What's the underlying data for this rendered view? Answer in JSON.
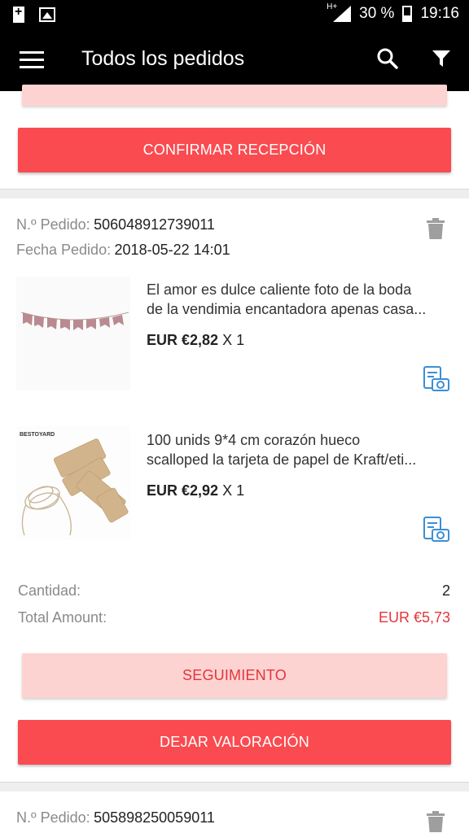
{
  "status_bar": {
    "network": "H+",
    "battery": "30 %",
    "time": "19:16"
  },
  "app_bar": {
    "title": "Todos los pedidos"
  },
  "top_button": {
    "label": "CONFIRMAR RECEPCIÓN"
  },
  "order1": {
    "order_no_label": "N.º Pedido:",
    "order_no": "506048912739011",
    "date_label": "Fecha Pedido:",
    "date": "2018-05-22 14:01",
    "items": [
      {
        "title_line1": "El amor es dulce caliente foto de la boda",
        "title_line2": "de la vendimia encantadora apenas casa...",
        "price": "EUR €2,82",
        "qty": "X 1",
        "image_text": "love is sweet"
      },
      {
        "title_line1": "100 unids 9*4 cm corazón hueco",
        "title_line2": "scalloped la tarjeta de papel de Kraft/eti...",
        "price": "EUR €2,92",
        "qty": "X 1",
        "image_brand": "BESTOYARD"
      }
    ],
    "quantity_label": "Cantidad:",
    "quantity": "2",
    "total_label": "Total Amount:",
    "total": "EUR €5,73",
    "tracking_button": "SEGUIMIENTO",
    "review_button": "DEJAR VALORACIÓN"
  },
  "order2": {
    "order_no_label": "N.º Pedido:",
    "order_no": "505898250059011"
  },
  "colors": {
    "accent": "#fa4b50",
    "accent_light": "#fdd3d2",
    "price_red": "#e3353b",
    "appbar": "#000000"
  }
}
